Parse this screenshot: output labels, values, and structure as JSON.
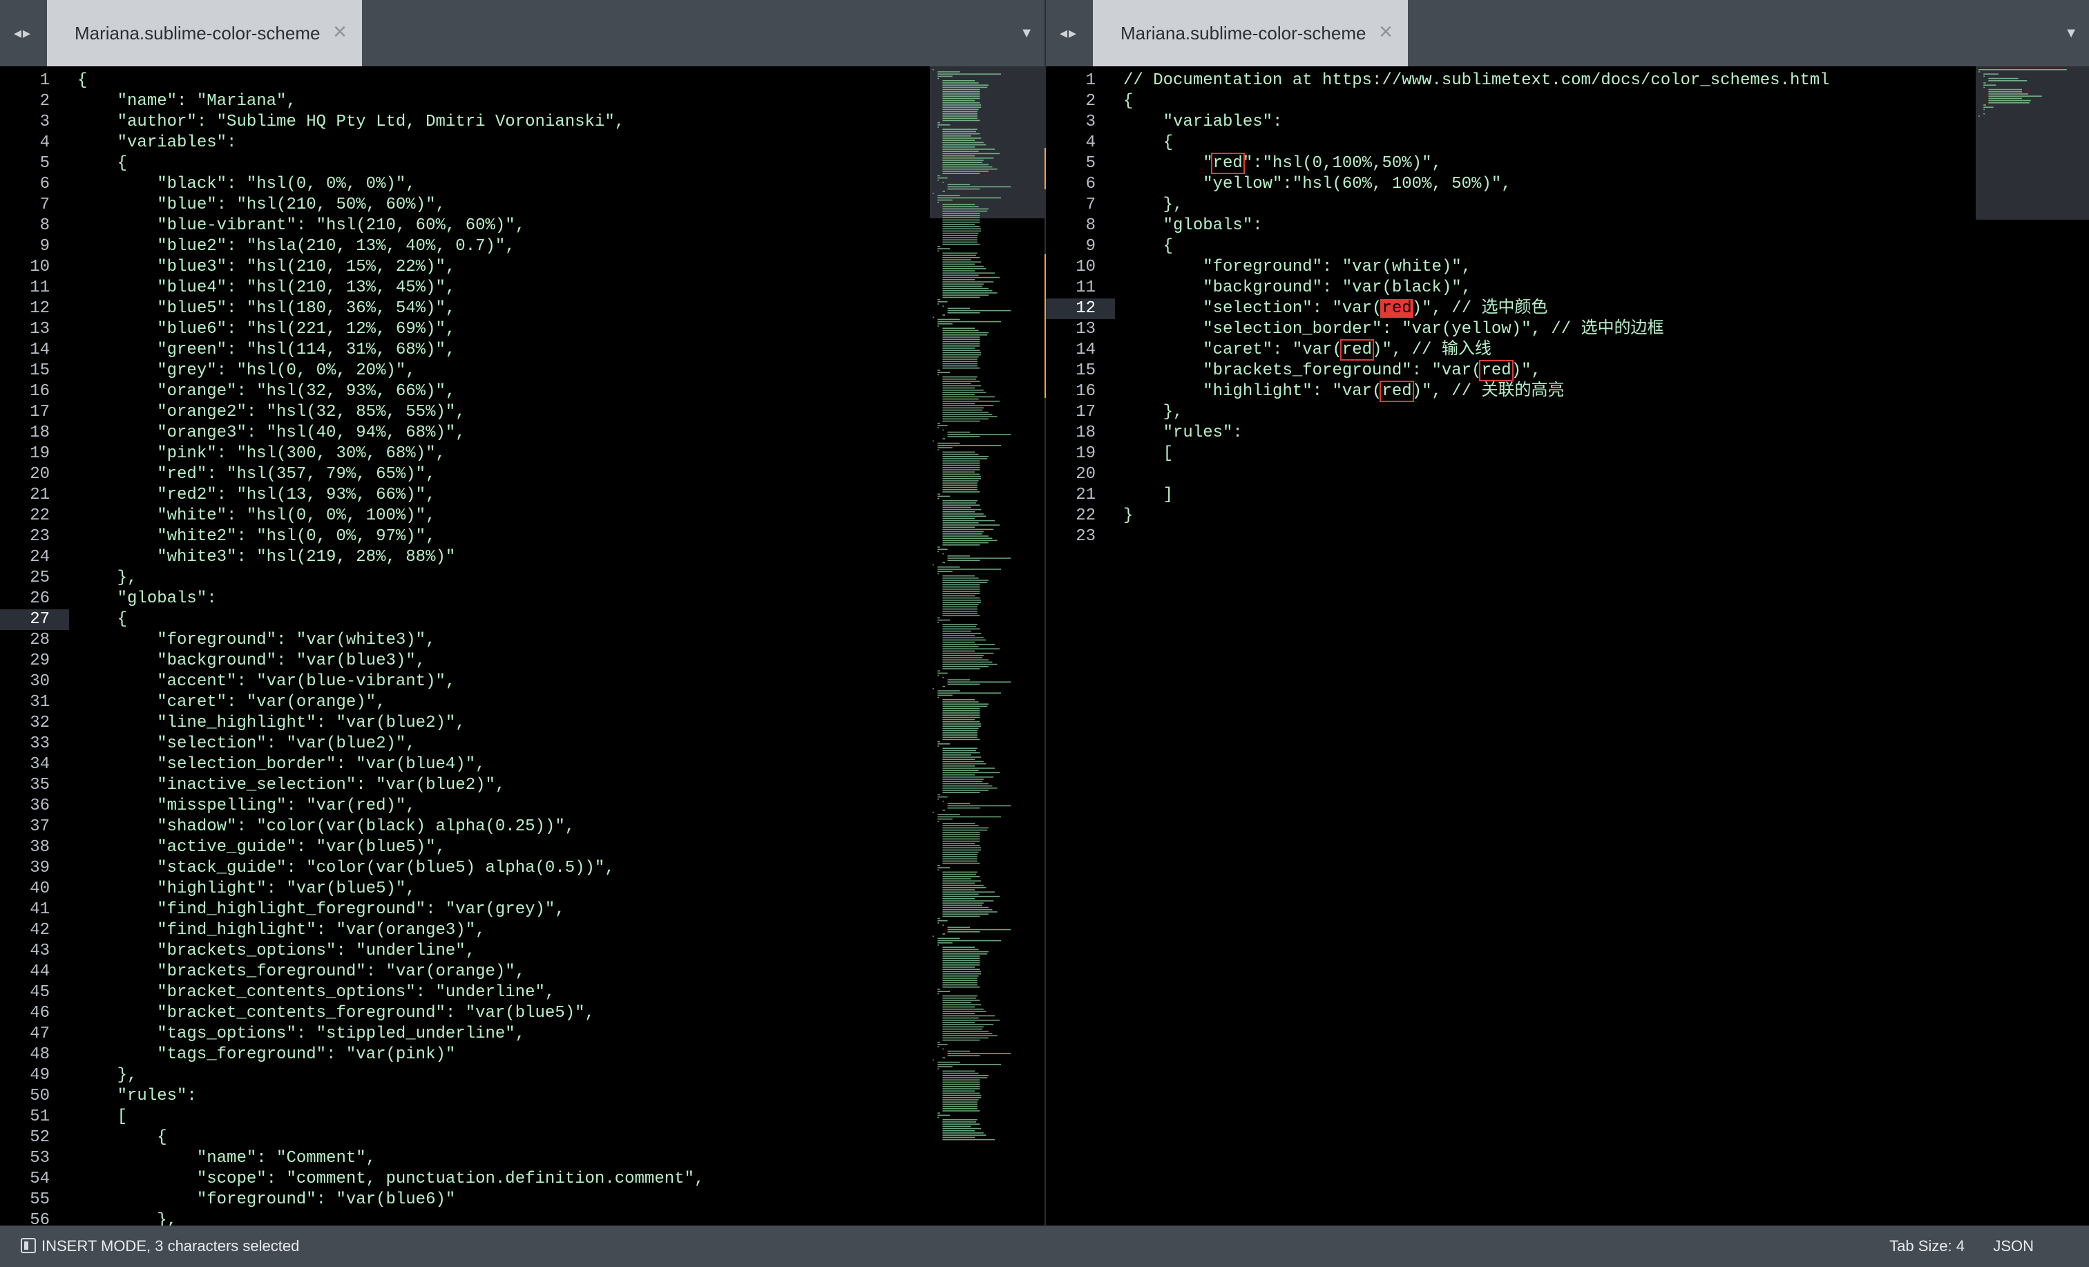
{
  "colors": {
    "text": "#b8f0c8",
    "line_number": "#b8bfc7",
    "tab_bg": "#cdd1d6",
    "tabbar_bg": "#454b53",
    "highlight_border": "#e53935",
    "modified_marker": "#f2a33a"
  },
  "left_pane": {
    "tab_title": "Mariana.sublime-color-scheme",
    "active_line": 27,
    "lines": [
      "{",
      "    \"name\": \"Mariana\",",
      "    \"author\": \"Sublime HQ Pty Ltd, Dmitri Voronianski\",",
      "    \"variables\":",
      "    {",
      "        \"black\": \"hsl(0, 0%, 0%)\",",
      "        \"blue\": \"hsl(210, 50%, 60%)\",",
      "        \"blue-vibrant\": \"hsl(210, 60%, 60%)\",",
      "        \"blue2\": \"hsla(210, 13%, 40%, 0.7)\",",
      "        \"blue3\": \"hsl(210, 15%, 22%)\",",
      "        \"blue4\": \"hsl(210, 13%, 45%)\",",
      "        \"blue5\": \"hsl(180, 36%, 54%)\",",
      "        \"blue6\": \"hsl(221, 12%, 69%)\",",
      "        \"green\": \"hsl(114, 31%, 68%)\",",
      "        \"grey\": \"hsl(0, 0%, 20%)\",",
      "        \"orange\": \"hsl(32, 93%, 66%)\",",
      "        \"orange2\": \"hsl(32, 85%, 55%)\",",
      "        \"orange3\": \"hsl(40, 94%, 68%)\",",
      "        \"pink\": \"hsl(300, 30%, 68%)\",",
      "        \"red\": \"hsl(357, 79%, 65%)\",",
      "        \"red2\": \"hsl(13, 93%, 66%)\",",
      "        \"white\": \"hsl(0, 0%, 100%)\",",
      "        \"white2\": \"hsl(0, 0%, 97%)\",",
      "        \"white3\": \"hsl(219, 28%, 88%)\"",
      "    },",
      "    \"globals\":",
      "    {",
      "        \"foreground\": \"var(white3)\",",
      "        \"background\": \"var(blue3)\",",
      "        \"accent\": \"var(blue-vibrant)\",",
      "        \"caret\": \"var(orange)\",",
      "        \"line_highlight\": \"var(blue2)\",",
      "        \"selection\": \"var(blue2)\",",
      "        \"selection_border\": \"var(blue4)\",",
      "        \"inactive_selection\": \"var(blue2)\",",
      "        \"misspelling\": \"var(red)\",",
      "        \"shadow\": \"color(var(black) alpha(0.25))\",",
      "        \"active_guide\": \"var(blue5)\",",
      "        \"stack_guide\": \"color(var(blue5) alpha(0.5))\",",
      "        \"highlight\": \"var(blue5)\",",
      "        \"find_highlight_foreground\": \"var(grey)\",",
      "        \"find_highlight\": \"var(orange3)\",",
      "        \"brackets_options\": \"underline\",",
      "        \"brackets_foreground\": \"var(orange)\",",
      "        \"bracket_contents_options\": \"underline\",",
      "        \"bracket_contents_foreground\": \"var(blue5)\",",
      "        \"tags_options\": \"stippled_underline\",",
      "        \"tags_foreground\": \"var(pink)\"",
      "    },",
      "    \"rules\":",
      "    [",
      "        {",
      "            \"name\": \"Comment\",",
      "            \"scope\": \"comment, punctuation.definition.comment\",",
      "            \"foreground\": \"var(blue6)\"",
      "        },"
    ]
  },
  "right_pane": {
    "tab_title": "Mariana.sublime-color-scheme",
    "active_line": 12,
    "lines": [
      "// Documentation at https://www.sublimetext.com/docs/color_schemes.html",
      "{",
      "    \"variables\":",
      "    {",
      "        \"red\":\"hsl(0,100%,50%)\",",
      "        \"yellow\":\"hsl(60%, 100%, 50%)\",",
      "    },",
      "    \"globals\":",
      "    {",
      "        \"foreground\": \"var(white)\",",
      "        \"background\": \"var(black)\",",
      "        \"selection\": \"var(red)\", // 选中颜色",
      "        \"selection_border\": \"var(yellow)\", // 选中的边框",
      "        \"caret\": \"var(red)\", // 输入线",
      "        \"brackets_foreground\": \"var(red)\",",
      "        \"highlight\": \"var(red)\", // 关联的高亮",
      "    },",
      "    \"rules\":",
      "    [",
      "",
      "    ]",
      "}",
      ""
    ],
    "highlight_word": "red",
    "highlight_lines": [
      5,
      12,
      14,
      15,
      16
    ]
  },
  "status_bar": {
    "mode_text": "INSERT MODE, 3 characters selected",
    "tab_size": "Tab Size: 4",
    "syntax": "JSON"
  }
}
